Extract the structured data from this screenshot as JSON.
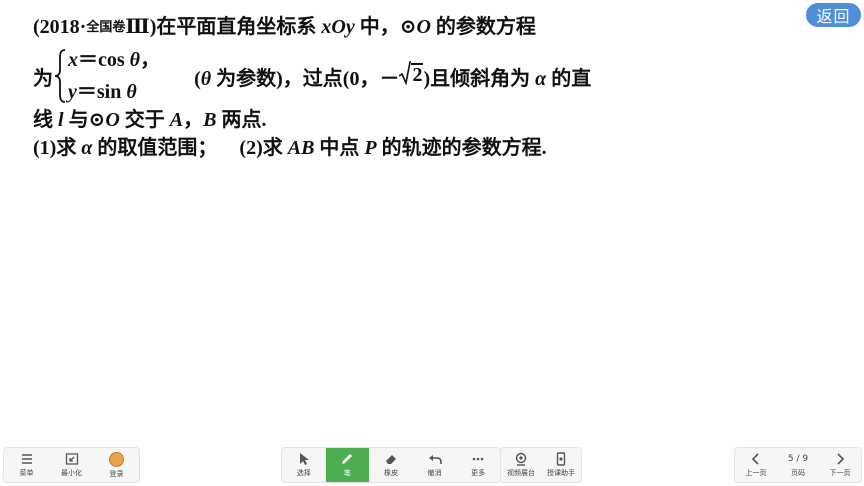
{
  "back_button": {
    "label": "返回"
  },
  "problem": {
    "source_open": "(2018·",
    "source_tag": "全国卷",
    "source_close": "Ⅲ)",
    "line1_a": "在平面直角坐标系 ",
    "line1_var": "xOy",
    "line1_b": " 中，⊙",
    "line1_o": "O",
    "line1_c": " 的参数方程",
    "wei": "为",
    "eq1_x": "x",
    "eq1_rest": "＝cos ",
    "eq1_theta": "θ",
    "eq1_comma": "，",
    "eq2_y": "y",
    "eq2_rest": "＝sin ",
    "eq2_theta": "θ",
    "line2_a": "(",
    "line2_theta": "θ",
    "line2_b": " 为参数)，过点(0，－",
    "sqrt_value": "2",
    "line2_c": ")且倾斜角为 ",
    "line2_alpha": "α",
    "line2_d": " 的直",
    "line3_a": "线 ",
    "line3_l": "l",
    "line3_b": " 与⊙",
    "line3_o": "O",
    "line3_c": " 交于 ",
    "line3_A": "A",
    "line3_d": "，",
    "line3_B": "B",
    "line3_e": " 两点.",
    "q1_a": "(1)求 ",
    "q1_alpha": "α",
    "q1_b": " 的取值范围；",
    "q2_a": "(2)求 ",
    "q2_AB": "AB",
    "q2_b": " 中点 ",
    "q2_P": "P",
    "q2_c": " 的轨迹的参数方程."
  },
  "toolbar": {
    "menu": "菜单",
    "minimize": "最小化",
    "login": "登录",
    "select": "选择",
    "pen": "笔",
    "eraser": "橡皮",
    "undo": "撤消",
    "more": "更多",
    "video_booth": "视频展台",
    "teaching_assistant": "授课助手",
    "prev_page": "上一页",
    "page_indicator": "5 / 9",
    "page_label": "页码",
    "next_page": "下一页"
  },
  "colors": {
    "accent_blue": "#4f8fd8",
    "active_green": "#4cae50"
  }
}
